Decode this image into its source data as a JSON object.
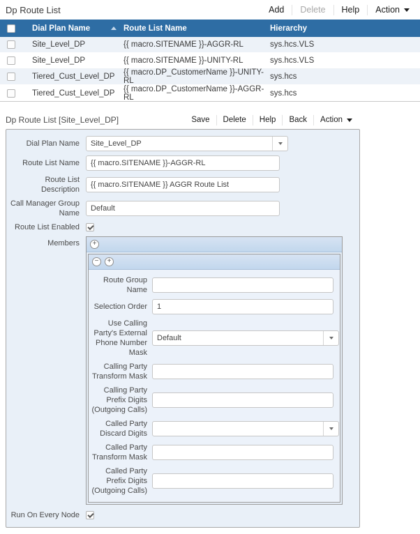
{
  "colors": {
    "table_header_bg": "#2e6da4",
    "row_alt_bg": "#edf2f8",
    "panel_bg": "#e9f0f8",
    "member_bar_bg": "#c2d7ed",
    "disabled_button_text": "#a8a8a8"
  },
  "list": {
    "title": "Dp Route List",
    "buttons": {
      "add": "Add",
      "delete": "Delete",
      "help": "Help",
      "action": "Action"
    },
    "columns": {
      "dial_plan": "Dial Plan Name",
      "route_list": "Route List Name",
      "hierarchy": "Hierarchy"
    },
    "rows": [
      {
        "dial_plan": "Site_Level_DP",
        "route_list": "{{ macro.SITENAME }}-AGGR-RL",
        "hierarchy": "sys.hcs.VLS"
      },
      {
        "dial_plan": "Site_Level_DP",
        "route_list": "{{ macro.SITENAME }}-UNITY-RL",
        "hierarchy": "sys.hcs.VLS"
      },
      {
        "dial_plan": "Tiered_Cust_Level_DP",
        "route_list": "{{ macro.DP_CustomerName }}-UNITY-RL",
        "hierarchy": "sys.hcs"
      },
      {
        "dial_plan": "Tiered_Cust_Level_DP",
        "route_list": "{{ macro.DP_CustomerName }}-AGGR-RL",
        "hierarchy": "sys.hcs"
      }
    ]
  },
  "detail": {
    "title": "Dp Route List [Site_Level_DP]",
    "buttons": {
      "save": "Save",
      "delete": "Delete",
      "help": "Help",
      "back": "Back",
      "action": "Action"
    },
    "fields": {
      "dial_plan_name": {
        "label": "Dial Plan Name",
        "value": "Site_Level_DP"
      },
      "route_list_name": {
        "label": "Route List Name",
        "value": "{{ macro.SITENAME }}-AGGR-RL"
      },
      "route_list_description": {
        "label": "Route List Description",
        "value": "{{ macro.SITENAME }} AGGR Route List"
      },
      "call_manager_group_name": {
        "label": "Call Manager Group Name",
        "value": "Default"
      },
      "route_list_enabled": {
        "label": "Route List Enabled",
        "checked": true
      },
      "members_label": "Members",
      "run_on_every_node": {
        "label": "Run On Every Node",
        "checked": true
      }
    },
    "member": {
      "route_group_name": {
        "label": "Route Group Name",
        "value": ""
      },
      "selection_order": {
        "label": "Selection Order",
        "value": "1"
      },
      "use_calling_party_mask": {
        "label": "Use Calling Party's External Phone Number Mask",
        "value": "Default"
      },
      "calling_party_transform_mask": {
        "label": "Calling Party Transform Mask",
        "value": ""
      },
      "calling_party_prefix_digits": {
        "label": "Calling Party Prefix Digits (Outgoing Calls)",
        "value": ""
      },
      "called_party_discard_digits": {
        "label": "Called Party Discard Digits",
        "value": ""
      },
      "called_party_transform_mask": {
        "label": "Called Party Transform Mask",
        "value": ""
      },
      "called_party_prefix_digits": {
        "label": "Called Party Prefix Digits (Outgoing Calls)",
        "value": ""
      }
    }
  }
}
